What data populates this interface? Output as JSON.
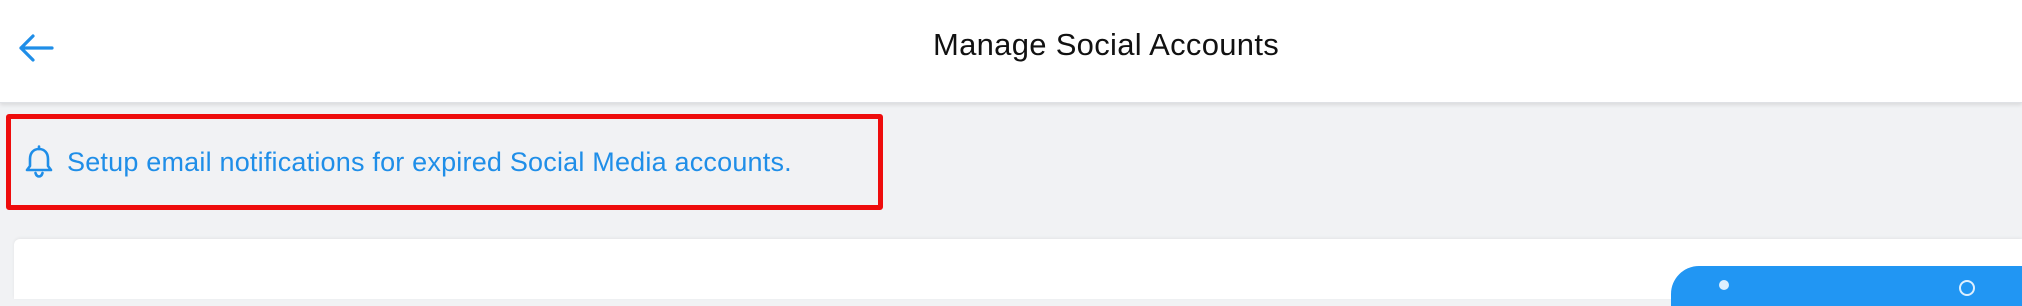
{
  "header": {
    "title": "Manage Social Accounts",
    "back_icon": "arrow-left-icon"
  },
  "notification_banner": {
    "icon": "bell-icon",
    "text": "Setup email notifications for expired Social Media accounts."
  },
  "colors": {
    "accent": "#1f8ee8",
    "highlight_border": "#ee0c0c",
    "page_background": "#f1f2f4",
    "button_blue": "#2196f3"
  }
}
